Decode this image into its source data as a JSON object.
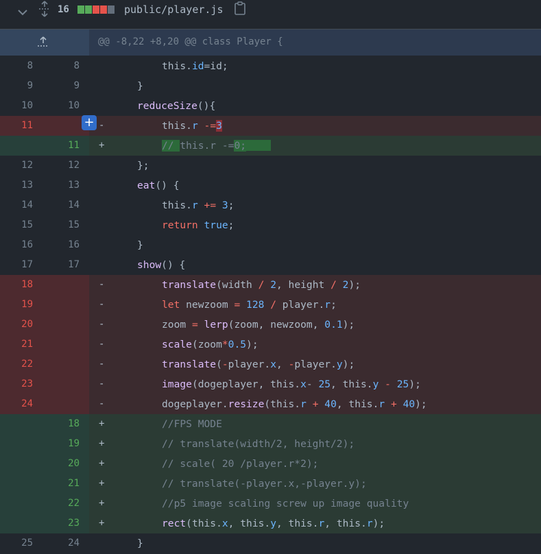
{
  "file": {
    "changes": "16",
    "path": "public/player.js",
    "diffstat": [
      "#57ab5a",
      "#57ab5a",
      "#e5534b",
      "#e5534b",
      "#636e7b"
    ]
  },
  "hunk": {
    "header": "@@ -8,22 +8,20 @@ class Player {"
  },
  "add_comment": "+",
  "lines": [
    {
      "type": "ctx",
      "old": "8",
      "new": "8",
      "sign": "",
      "indent": 2,
      "segs": [
        {
          "t": "this."
        },
        {
          "t": "id",
          "c": "p"
        },
        {
          "t": "=id;"
        }
      ]
    },
    {
      "type": "ctx",
      "old": "9",
      "new": "9",
      "sign": "",
      "indent": 1,
      "segs": [
        {
          "t": "}"
        }
      ]
    },
    {
      "type": "ctx",
      "old": "10",
      "new": "10",
      "sign": "",
      "indent": 1,
      "segs": [
        {
          "t": "reduceSize",
          "c": "f"
        },
        {
          "t": "(){"
        }
      ]
    },
    {
      "type": "del",
      "old": "11",
      "new": "",
      "sign": "-",
      "indent": 2,
      "comment": true,
      "segs": [
        {
          "t": "this."
        },
        {
          "t": "r",
          "c": "p"
        },
        {
          "t": " "
        },
        {
          "t": "-=",
          "c": "k"
        },
        {
          "t": "3",
          "c": "p hl-del"
        }
      ]
    },
    {
      "type": "add",
      "old": "",
      "new": "11",
      "sign": "+",
      "indent": 2,
      "segs": [
        {
          "t": "// ",
          "c": "c hl-add"
        },
        {
          "t": "this.r -=",
          "c": "c"
        },
        {
          "t": "0;",
          "c": "c hl-add"
        },
        {
          "t": "",
          "c": "hl-add-empty"
        }
      ]
    },
    {
      "type": "ctx",
      "old": "12",
      "new": "12",
      "sign": "",
      "indent": 1,
      "segs": [
        {
          "t": "};"
        }
      ]
    },
    {
      "type": "ctx",
      "old": "13",
      "new": "13",
      "sign": "",
      "indent": 1,
      "segs": [
        {
          "t": "eat",
          "c": "f"
        },
        {
          "t": "() {"
        }
      ]
    },
    {
      "type": "ctx",
      "old": "14",
      "new": "14",
      "sign": "",
      "indent": 2,
      "segs": [
        {
          "t": "this."
        },
        {
          "t": "r",
          "c": "p"
        },
        {
          "t": " "
        },
        {
          "t": "+=",
          "c": "k"
        },
        {
          "t": " "
        },
        {
          "t": "3",
          "c": "p"
        },
        {
          "t": ";"
        }
      ]
    },
    {
      "type": "ctx",
      "old": "15",
      "new": "15",
      "sign": "",
      "indent": 2,
      "segs": [
        {
          "t": "return",
          "c": "k"
        },
        {
          "t": " "
        },
        {
          "t": "true",
          "c": "p"
        },
        {
          "t": ";"
        }
      ]
    },
    {
      "type": "ctx",
      "old": "16",
      "new": "16",
      "sign": "",
      "indent": 1,
      "segs": [
        {
          "t": "}"
        }
      ]
    },
    {
      "type": "ctx",
      "old": "17",
      "new": "17",
      "sign": "",
      "indent": 1,
      "segs": [
        {
          "t": "show",
          "c": "f"
        },
        {
          "t": "() {"
        }
      ]
    },
    {
      "type": "del",
      "old": "18",
      "new": "",
      "sign": "-",
      "indent": 2,
      "segs": [
        {
          "t": "translate",
          "c": "f"
        },
        {
          "t": "(width "
        },
        {
          "t": "/",
          "c": "k"
        },
        {
          "t": " "
        },
        {
          "t": "2",
          "c": "p"
        },
        {
          "t": ", height "
        },
        {
          "t": "/",
          "c": "k"
        },
        {
          "t": " "
        },
        {
          "t": "2",
          "c": "p"
        },
        {
          "t": ");"
        }
      ]
    },
    {
      "type": "del",
      "old": "19",
      "new": "",
      "sign": "-",
      "indent": 2,
      "segs": [
        {
          "t": "let",
          "c": "k"
        },
        {
          "t": " newzoom "
        },
        {
          "t": "=",
          "c": "k"
        },
        {
          "t": " "
        },
        {
          "t": "128",
          "c": "p"
        },
        {
          "t": " "
        },
        {
          "t": "/",
          "c": "k"
        },
        {
          "t": " player."
        },
        {
          "t": "r",
          "c": "p"
        },
        {
          "t": ";"
        }
      ]
    },
    {
      "type": "del",
      "old": "20",
      "new": "",
      "sign": "-",
      "indent": 2,
      "segs": [
        {
          "t": "zoom "
        },
        {
          "t": "=",
          "c": "k"
        },
        {
          "t": " "
        },
        {
          "t": "lerp",
          "c": "f"
        },
        {
          "t": "(zoom, newzoom, "
        },
        {
          "t": "0.1",
          "c": "p"
        },
        {
          "t": ");"
        }
      ]
    },
    {
      "type": "del",
      "old": "21",
      "new": "",
      "sign": "-",
      "indent": 2,
      "segs": [
        {
          "t": "scale",
          "c": "f"
        },
        {
          "t": "(zoom"
        },
        {
          "t": "*",
          "c": "k"
        },
        {
          "t": "0.5",
          "c": "p"
        },
        {
          "t": ");"
        }
      ]
    },
    {
      "type": "del",
      "old": "22",
      "new": "",
      "sign": "-",
      "indent": 2,
      "segs": [
        {
          "t": "translate",
          "c": "f"
        },
        {
          "t": "("
        },
        {
          "t": "-",
          "c": "k"
        },
        {
          "t": "player."
        },
        {
          "t": "x",
          "c": "p"
        },
        {
          "t": ", "
        },
        {
          "t": "-",
          "c": "k"
        },
        {
          "t": "player."
        },
        {
          "t": "y",
          "c": "p"
        },
        {
          "t": ");"
        }
      ]
    },
    {
      "type": "del",
      "old": "23",
      "new": "",
      "sign": "-",
      "indent": 2,
      "segs": [
        {
          "t": "image",
          "c": "f"
        },
        {
          "t": "(dogeplayer, this."
        },
        {
          "t": "x",
          "c": "p"
        },
        {
          "t": "- "
        },
        {
          "t": "25",
          "c": "p"
        },
        {
          "t": ", this."
        },
        {
          "t": "y",
          "c": "p"
        },
        {
          "t": " "
        },
        {
          "t": "-",
          "c": "k"
        },
        {
          "t": " "
        },
        {
          "t": "25",
          "c": "p"
        },
        {
          "t": ");"
        }
      ]
    },
    {
      "type": "del",
      "old": "24",
      "new": "",
      "sign": "-",
      "indent": 2,
      "segs": [
        {
          "t": "dogeplayer."
        },
        {
          "t": "resize",
          "c": "f"
        },
        {
          "t": "(this."
        },
        {
          "t": "r",
          "c": "p"
        },
        {
          "t": " "
        },
        {
          "t": "+",
          "c": "k"
        },
        {
          "t": " "
        },
        {
          "t": "40",
          "c": "p"
        },
        {
          "t": ", this."
        },
        {
          "t": "r",
          "c": "p"
        },
        {
          "t": " "
        },
        {
          "t": "+",
          "c": "k"
        },
        {
          "t": " "
        },
        {
          "t": "40",
          "c": "p"
        },
        {
          "t": ");"
        }
      ]
    },
    {
      "type": "add",
      "old": "",
      "new": "18",
      "sign": "+",
      "indent": 2,
      "segs": [
        {
          "t": "//FPS MODE",
          "c": "c"
        }
      ]
    },
    {
      "type": "add",
      "old": "",
      "new": "19",
      "sign": "+",
      "indent": 2,
      "segs": [
        {
          "t": "// translate(width/2, height/2);",
          "c": "c"
        }
      ]
    },
    {
      "type": "add",
      "old": "",
      "new": "20",
      "sign": "+",
      "indent": 2,
      "segs": [
        {
          "t": "// scale( 20 /player.r*2);",
          "c": "c"
        }
      ]
    },
    {
      "type": "add",
      "old": "",
      "new": "21",
      "sign": "+",
      "indent": 2,
      "segs": [
        {
          "t": "// translate(-player.x,-player.y);",
          "c": "c"
        }
      ]
    },
    {
      "type": "add",
      "old": "",
      "new": "22",
      "sign": "+",
      "indent": 2,
      "segs": [
        {
          "t": "//p5 image scaling screw up image quality",
          "c": "c"
        }
      ]
    },
    {
      "type": "add",
      "old": "",
      "new": "23",
      "sign": "+",
      "indent": 2,
      "segs": [
        {
          "t": "rect",
          "c": "f"
        },
        {
          "t": "(this."
        },
        {
          "t": "x",
          "c": "p"
        },
        {
          "t": ", this."
        },
        {
          "t": "y",
          "c": "p"
        },
        {
          "t": ", this."
        },
        {
          "t": "r",
          "c": "p"
        },
        {
          "t": ", this."
        },
        {
          "t": "r",
          "c": "p"
        },
        {
          "t": ");"
        }
      ]
    },
    {
      "type": "ctx",
      "old": "25",
      "new": "24",
      "sign": "",
      "indent": 1,
      "segs": [
        {
          "t": "}"
        }
      ]
    }
  ]
}
